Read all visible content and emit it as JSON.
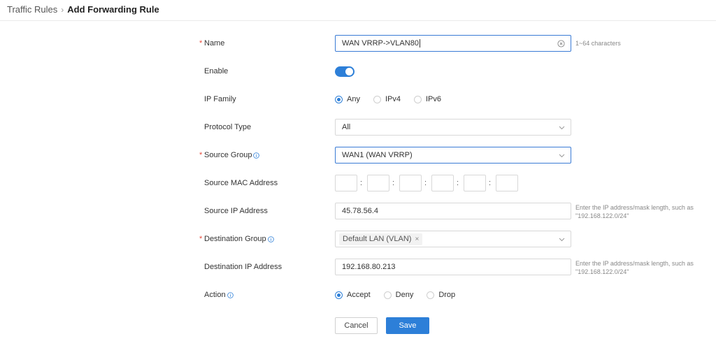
{
  "breadcrumb": {
    "parent": "Traffic Rules",
    "separator": "›",
    "current": "Add Forwarding Rule"
  },
  "form": {
    "name": {
      "label": "Name",
      "required": "*",
      "value": "WAN VRRP->VLAN80",
      "hint": "1~64 characters",
      "icon": "clear-circle-icon"
    },
    "enable": {
      "label": "Enable",
      "on": true
    },
    "ip_family": {
      "label": "IP Family",
      "options": [
        "Any",
        "IPv4",
        "IPv6"
      ],
      "selected": "Any"
    },
    "protocol_type": {
      "label": "Protocol Type",
      "value": "All"
    },
    "source_group": {
      "label": "Source Group",
      "required": "*",
      "value": "WAN1 (WAN VRRP)"
    },
    "source_mac": {
      "label": "Source MAC Address",
      "segments": [
        "",
        "",
        "",
        "",
        "",
        ""
      ],
      "separator": ":"
    },
    "source_ip": {
      "label": "Source IP Address",
      "value": "45.78.56.4",
      "hint_line1": "Enter the IP address/mask length, such as",
      "hint_line2": "\"192.168.122.0/24\""
    },
    "destination_group": {
      "label": "Destination Group",
      "required": "*",
      "tag": "Default LAN (VLAN)",
      "tag_close": "×"
    },
    "destination_ip": {
      "label": "Destination IP Address",
      "value": "192.168.80.213",
      "hint_line1": "Enter the IP address/mask length, such as",
      "hint_line2": "\"192.168.122.0/24\""
    },
    "action": {
      "label": "Action",
      "options": [
        "Accept",
        "Deny",
        "Drop"
      ],
      "selected": "Accept"
    }
  },
  "buttons": {
    "cancel": "Cancel",
    "save": "Save"
  },
  "colors": {
    "accent": "#2d7fd8",
    "required": "#e74c3c",
    "border": "#d8d8d8"
  }
}
